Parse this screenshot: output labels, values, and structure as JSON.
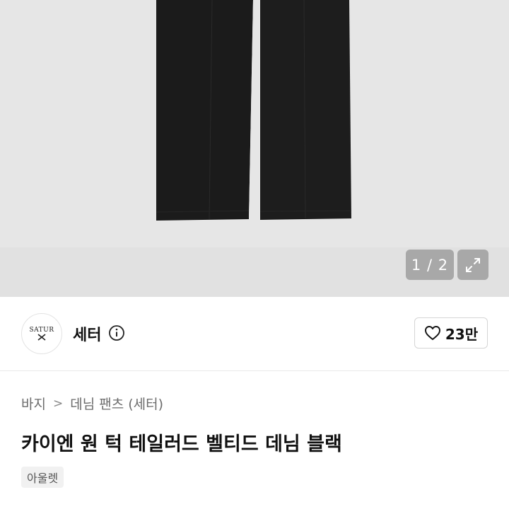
{
  "gallery": {
    "page_indicator": "1 / 2",
    "expand_icon": "expand-icon"
  },
  "store": {
    "avatar_text_top": "SATUR",
    "name": "세터",
    "info_icon": "info-icon",
    "like_icon": "heart-icon",
    "like_count": "23만"
  },
  "breadcrumb": {
    "items": [
      "바지",
      "데님 팬츠 (세터)"
    ],
    "separator": ">"
  },
  "product": {
    "title": "카이엔 원 턱 테일러드 벨티드 데님 블랙",
    "tag": "아울렛"
  },
  "colors": {
    "gallery_bg": "#e6e6e6",
    "denim": "#1b1b1b",
    "overlay_button": "#a8a8a8"
  }
}
